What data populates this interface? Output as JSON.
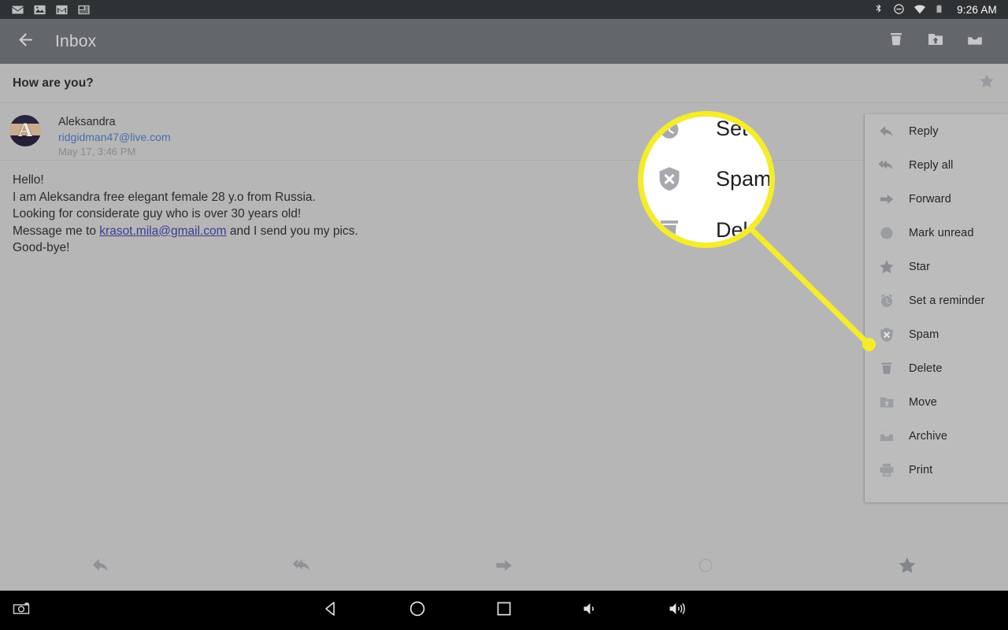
{
  "status_bar": {
    "left_icons": [
      "mail-icon",
      "image-icon",
      "gmail-icon",
      "news-icon"
    ],
    "right_icons": [
      "bluetooth-icon",
      "do-not-disturb-icon",
      "wifi-icon",
      "battery-icon"
    ],
    "clock": "9:26 AM"
  },
  "app_bar": {
    "back_label": "back-arrow",
    "title": "Inbox",
    "actions": [
      {
        "name": "delete-action",
        "icon": "trash-icon"
      },
      {
        "name": "move-action",
        "icon": "folder-up-icon"
      },
      {
        "name": "archive-action",
        "icon": "archive-icon"
      }
    ]
  },
  "message": {
    "subject": "How are you?",
    "starred_icon": "star-icon",
    "sender_name": "Aleksandra",
    "sender_email": "ridgidman47@live.com",
    "date": "May 17, 3:46 PM",
    "avatar_initial": "A",
    "body_lines": [
      {
        "text": "Hello!"
      },
      {
        "text": "I am Aleksandra free elegant female 28 y.o from Russia."
      },
      {
        "text": "Looking for considerate guy who is over 30 years old!"
      },
      {
        "prefix": "Message me to ",
        "link": "krasot.mila@gmail.com",
        "suffix": " and I send you my pics."
      },
      {
        "text": "Good-bye!"
      }
    ]
  },
  "bottom_toolbar": [
    {
      "name": "reply-button",
      "icon": "reply-icon"
    },
    {
      "name": "reply-all-button",
      "icon": "reply-all-icon"
    },
    {
      "name": "forward-button",
      "icon": "forward-icon"
    },
    {
      "name": "mark-unread-button",
      "icon": "circle-outline-icon"
    },
    {
      "name": "star-button",
      "icon": "star-icon"
    }
  ],
  "popup_menu": {
    "items": [
      {
        "label": "Reply",
        "icon": "reply-icon"
      },
      {
        "label": "Reply all",
        "icon": "reply-all-icon"
      },
      {
        "label": "Forward",
        "icon": "forward-icon"
      },
      {
        "label": "Mark unread",
        "icon": "circle-filled-icon"
      },
      {
        "label": "Star",
        "icon": "star-icon"
      },
      {
        "label": "Set a reminder",
        "icon": "clock-icon"
      },
      {
        "label": "Spam",
        "icon": "shield-x-icon"
      },
      {
        "label": "Delete",
        "icon": "trash-icon"
      },
      {
        "label": "Move",
        "icon": "folder-up-icon"
      },
      {
        "label": "Archive",
        "icon": "archive-icon"
      },
      {
        "label": "Print",
        "icon": "printer-icon"
      }
    ]
  },
  "magnifier": {
    "highlight_color": "#f5ec2b",
    "rows": [
      {
        "label": "Set a r",
        "icon": "clock-icon"
      },
      {
        "label": "Spam",
        "icon": "shield-x-icon"
      },
      {
        "label": "Delet",
        "icon": "trash-icon"
      }
    ],
    "target_item": "Spam"
  },
  "nav_bar": {
    "buttons": [
      {
        "name": "screenshot-button",
        "icon": "camera-icon"
      },
      {
        "name": "back-button",
        "icon": "triangle-back-icon"
      },
      {
        "name": "home-button",
        "icon": "circle-home-icon"
      },
      {
        "name": "recents-button",
        "icon": "square-recents-icon"
      },
      {
        "name": "volume-down-button",
        "icon": "volume-down-icon"
      },
      {
        "name": "volume-up-button",
        "icon": "volume-up-icon"
      }
    ]
  }
}
